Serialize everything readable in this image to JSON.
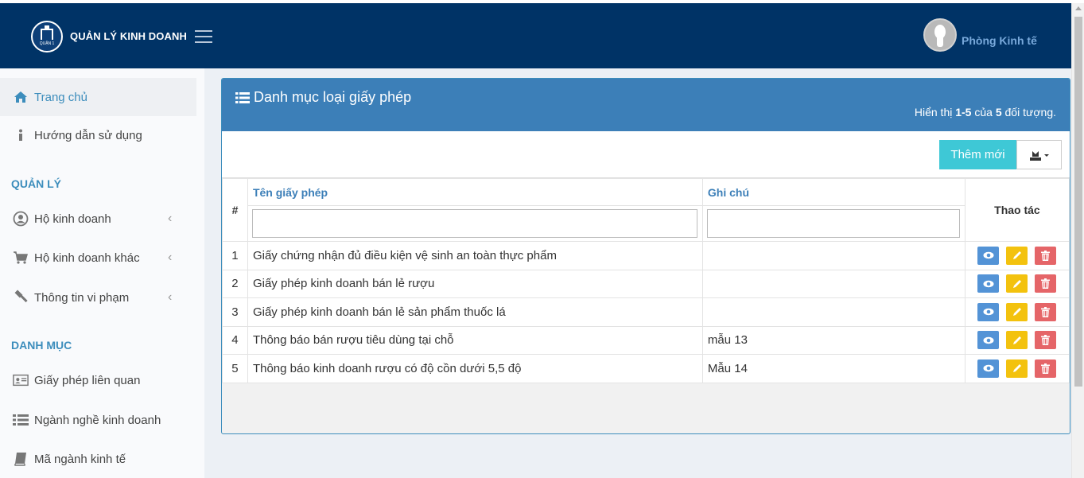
{
  "header": {
    "logo_text": "QUẬN 1",
    "brand": "QUẢN LÝ KINH DOANH",
    "user_name": "Phòng Kinh tế"
  },
  "sidebar": {
    "items": [
      {
        "label": "Trang chủ",
        "icon": "home-icon"
      },
      {
        "label": "Hướng dẫn sử dụng",
        "icon": "info-icon"
      }
    ],
    "section_manage": "QUẢN LÝ",
    "manage_items": [
      {
        "label": "Hộ kinh doanh",
        "icon": "user-circle-icon"
      },
      {
        "label": "Hộ kinh doanh khác",
        "icon": "cart-icon"
      },
      {
        "label": "Thông tin vi phạm",
        "icon": "gavel-icon"
      }
    ],
    "section_catalog": "DANH MỤC",
    "catalog_items": [
      {
        "label": "Giấy phép liên quan",
        "icon": "id-card-icon"
      },
      {
        "label": "Ngành nghề kinh doanh",
        "icon": "list-icon"
      },
      {
        "label": "Mã ngành kinh tế",
        "icon": "book-icon"
      }
    ]
  },
  "panel": {
    "title": "Danh mục loại giấy phép",
    "summary_prefix": "Hiển thị ",
    "summary_range": "1-5",
    "summary_mid": " của ",
    "summary_total": "5",
    "summary_suffix": " đối tượng.",
    "add_button": "Thêm mới"
  },
  "table": {
    "col_num": "#",
    "col_name": "Tên giấy phép",
    "col_note": "Ghi chú",
    "col_actions": "Thao tác",
    "rows": [
      {
        "num": "1",
        "name": "Giấy chứng nhận đủ điều kiện vệ sinh an toàn thực phẩm",
        "note": ""
      },
      {
        "num": "2",
        "name": "Giấy phép kinh doanh bán lẻ rượu",
        "note": ""
      },
      {
        "num": "3",
        "name": "Giấy phép kinh doanh bán lẻ sản phẩm thuốc lá",
        "note": ""
      },
      {
        "num": "4",
        "name": "Thông báo bán rượu tiêu dùng tại chỗ",
        "note": "mẫu 13"
      },
      {
        "num": "5",
        "name": "Thông báo kinh doanh rượu có độ cồn dưới 5,5 độ",
        "note": "Mẫu 14"
      }
    ]
  },
  "colors": {
    "header_bg": "#003366",
    "panel_head": "#3c7fb8",
    "add_btn": "#3ec8d6",
    "view_btn": "#5393d6",
    "edit_btn": "#f3c20e",
    "delete_btn": "#e56568"
  }
}
